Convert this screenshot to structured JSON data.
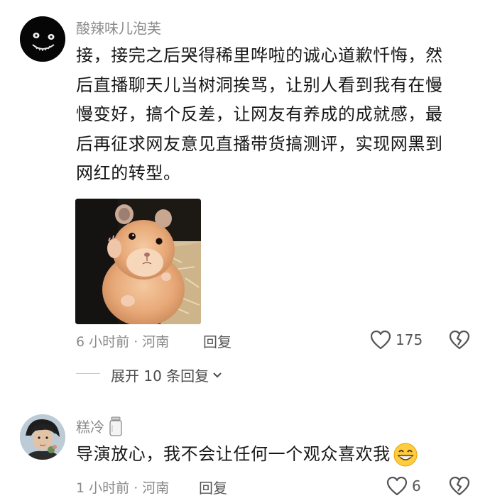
{
  "comments": [
    {
      "username": "酸辣味儿泡芙",
      "lines": [
        "接，接完之后哭得稀里哗啦的诚心道歉忏悔，然",
        "后直播聊天儿当树洞挨骂，让别人看到我有在慢",
        "慢变好，搞个反差，让网友有养成的成就感，最",
        "后再征求网友意见直播带货搞测评，实现网黑到",
        "网红的转型。"
      ],
      "time": "6 小时前",
      "location": "河南",
      "reply_label": "回复",
      "likes": "175",
      "icons": {
        "like": "heart-outline-icon",
        "dislike": "broken-heart-icon"
      },
      "replies_expand": "展开 10 条回复"
    },
    {
      "username": "糕冷",
      "text": "导演放心，我不会让任何一个观众喜欢我",
      "time": "1 小时前",
      "location": "河南",
      "reply_label": "回复",
      "likes": "6",
      "icons": {
        "badge": "jar-icon",
        "emoji": "grin-emoji-icon",
        "like": "heart-outline-icon",
        "dislike": "broken-heart-icon"
      }
    }
  ]
}
